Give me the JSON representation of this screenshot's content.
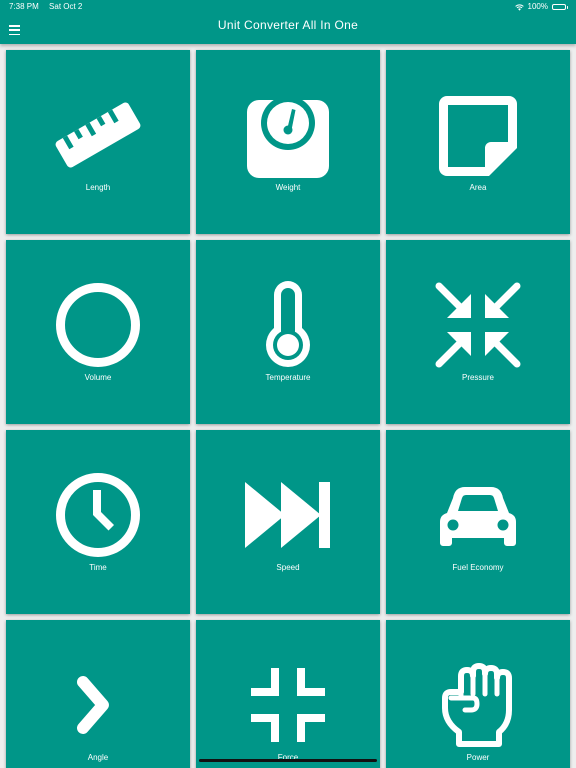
{
  "status_bar": {
    "time": "7:38 PM",
    "date": "Sat Oct 2",
    "battery": "100%",
    "battery_level": 1.0
  },
  "app_bar": {
    "title": "Unit Converter All In One",
    "menu_icon": "hamburger-menu-icon"
  },
  "colors": {
    "primary": "#009688",
    "on_primary": "#ffffff",
    "background": "#eeeeee"
  },
  "categories": [
    {
      "label": "Length",
      "icon": "ruler-icon"
    },
    {
      "label": "Weight",
      "icon": "scale-icon"
    },
    {
      "label": "Area",
      "icon": "note-icon"
    },
    {
      "label": "Volume",
      "icon": "circle-icon"
    },
    {
      "label": "Temperature",
      "icon": "thermometer-icon"
    },
    {
      "label": "Pressure",
      "icon": "compress-arrows-icon"
    },
    {
      "label": "Time",
      "icon": "clock-icon"
    },
    {
      "label": "Speed",
      "icon": "fast-forward-icon"
    },
    {
      "label": "Fuel Economy",
      "icon": "car-icon"
    },
    {
      "label": "Angle",
      "icon": "chevron-right-icon"
    },
    {
      "label": "Force",
      "icon": "fullscreen-exit-icon"
    },
    {
      "label": "Power",
      "icon": "fist-icon"
    }
  ]
}
